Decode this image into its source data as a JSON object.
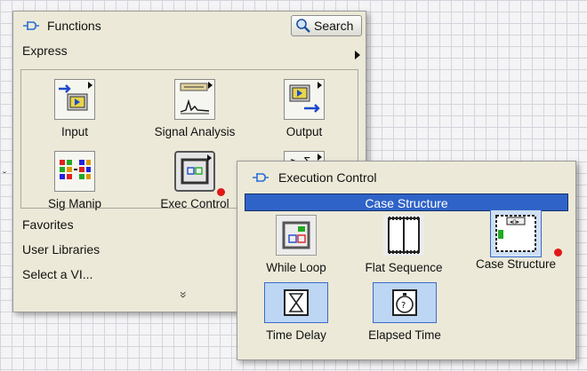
{
  "functions_palette": {
    "title": "Functions",
    "search_label": "Search",
    "category": "Express",
    "items": [
      {
        "label": "Input",
        "icon": "input-icon"
      },
      {
        "label": "Signal Analysis",
        "icon": "signal-analysis-icon"
      },
      {
        "label": "Output",
        "icon": "output-icon"
      },
      {
        "label": "Sig Manip",
        "icon": "sig-manip-icon"
      },
      {
        "label": "Exec Control",
        "icon": "exec-control-icon"
      },
      {
        "label": "",
        "icon": "arith-compare-icon"
      }
    ],
    "categories": [
      "Favorites",
      "User Libraries",
      "Select a VI..."
    ],
    "more_glyph": "»"
  },
  "exec_palette": {
    "title": "Execution Control",
    "highlight": "Case Structure",
    "items": [
      {
        "label": "While Loop",
        "icon": "while-loop-icon"
      },
      {
        "label": "Flat Sequence",
        "icon": "flat-sequence-icon"
      },
      {
        "label": "Case Structure",
        "icon": "case-structure-icon"
      },
      {
        "label": "Time Delay",
        "icon": "time-delay-icon"
      },
      {
        "label": "Elapsed Time",
        "icon": "elapsed-time-icon"
      }
    ]
  },
  "colors": {
    "palette_bg": "#ece9d8",
    "highlight": "#2f63c7",
    "accent_red": "#e11818",
    "selection_bg": "#bcd6f4"
  }
}
